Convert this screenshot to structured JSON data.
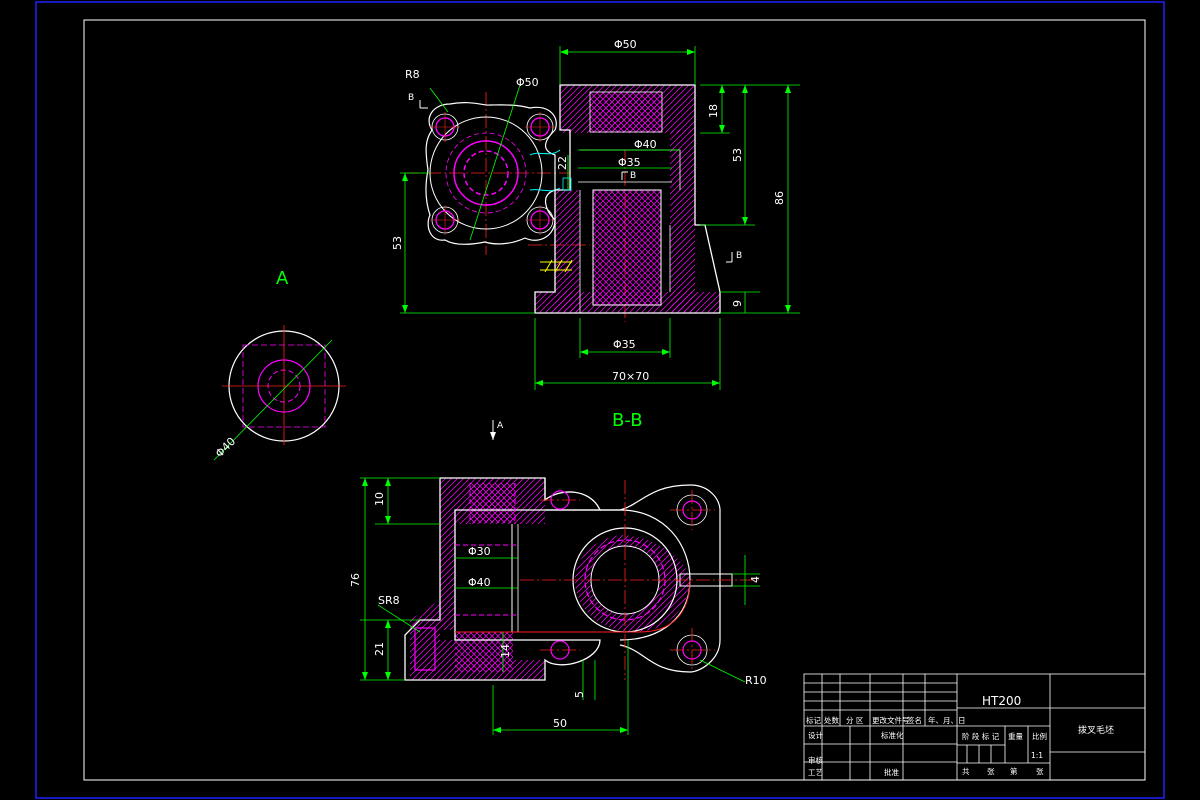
{
  "drawing": {
    "views": {
      "a": "A",
      "bb": "B-B"
    },
    "section_arrows": {
      "b_top": "B",
      "b_mid": "B",
      "b_right": "B",
      "a_arrow": "A"
    },
    "dimensions": {
      "r8": "R8",
      "phi50_top": "Φ50",
      "phi50_dia": "Φ50",
      "h18": "18",
      "h53_right": "53",
      "h86": "86",
      "phi40_inner": "Φ40",
      "phi35_inner": "Φ35",
      "h22": "22",
      "h53_left": "53",
      "h9": "9",
      "phi35_bottom": "Φ35",
      "base_70x70": "70×70",
      "phi40_view_a": "Φ40",
      "h10": "10",
      "phi30": "Φ30",
      "phi40_bottom": "Φ40",
      "h76": "76",
      "sr8": "SR8",
      "h21": "21",
      "h14": "14",
      "gap4": "4",
      "w5": "5",
      "w50": "50",
      "r10": "R10"
    }
  },
  "title_block": {
    "material": "HT200",
    "part_name": "拨叉毛坯",
    "scale": "1:1",
    "rev_headers": [
      "标记",
      "处数",
      "分 区",
      "更改文件号",
      "签名",
      "年、月、日"
    ],
    "sign_labels": [
      "设计",
      "标准化"
    ],
    "review_labels": [
      "审核",
      "工艺",
      "批准"
    ],
    "stage_headers": [
      "阶 段 标 记",
      "重量",
      "比例"
    ],
    "sheet_labels": [
      "共",
      "张",
      "第",
      "张"
    ]
  },
  "colors": {
    "outline": "#ffffff",
    "centerline": "#ff2020",
    "dimension": "#00ff00",
    "hidden": "#ff00ff",
    "hatch": "#ff00ff",
    "frame": "#2020ff",
    "cyan": "#00ffff",
    "yellow": "#ffff00"
  }
}
